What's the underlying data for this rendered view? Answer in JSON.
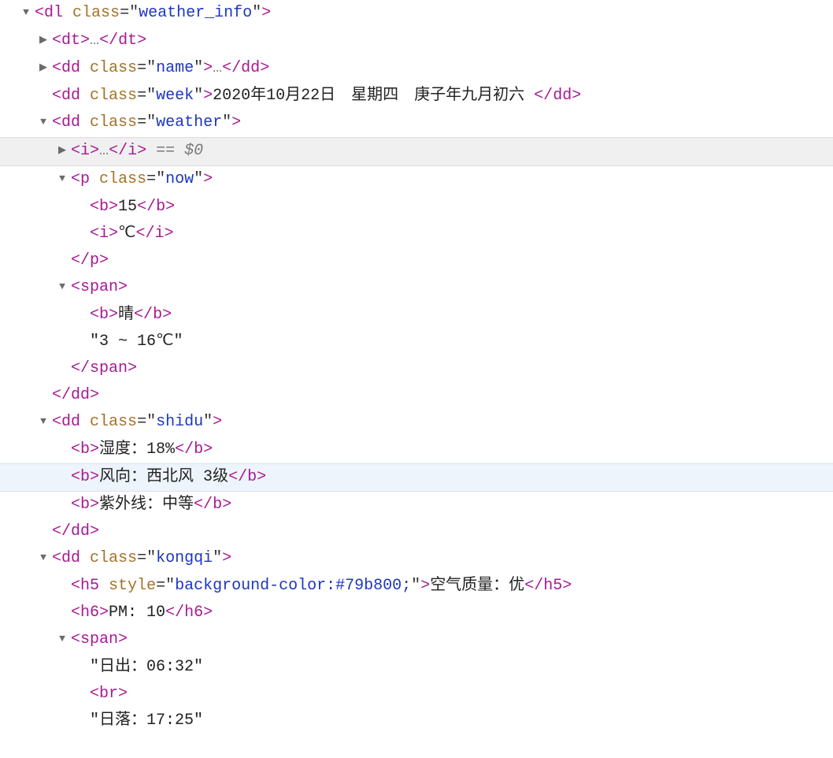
{
  "punct": {
    "lt": "<",
    "gt": ">",
    "close": "</",
    "eq": "=",
    "q": "\"",
    "ell": "…"
  },
  "tags": {
    "dl": "dl",
    "dt": "dt",
    "dd": "dd",
    "i": "i",
    "p": "p",
    "b": "b",
    "span": "span",
    "h5": "h5",
    "h6": "h6",
    "br": "br"
  },
  "attrs": {
    "class": "class",
    "style": "style"
  },
  "classes": {
    "weather_info": "weather_info",
    "name": "name",
    "week": "week",
    "weather": "weather",
    "now": "now",
    "shidu": "shidu",
    "kongqi": "kongqi"
  },
  "text": {
    "week": "2020年10月22日　星期四　庚子年九月初六 ",
    "dollar0": " == $0",
    "b15": "15",
    "deg": "℃",
    "qing": "晴",
    "range": "\"3 ~ 16℃\"",
    "humid": "湿度：18%",
    "wind": "风向：西北风 3级",
    "uv": "紫外线：中等",
    "h5style": "background-color:#79b800;",
    "air": "空气质量：优",
    "pm": "PM: 10",
    "sunrise": "\"日出：06:32\"",
    "sunset": "\"日落：17:25\""
  }
}
